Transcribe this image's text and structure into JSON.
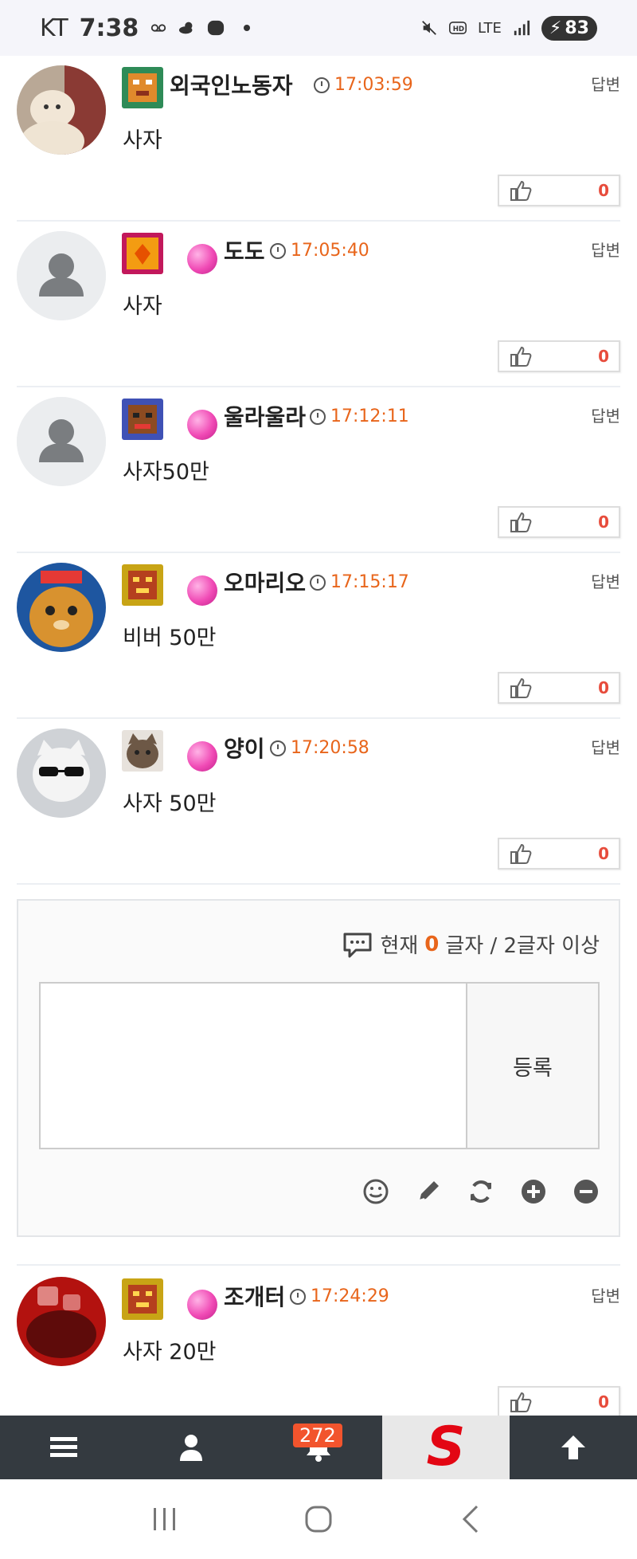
{
  "status_bar": {
    "carrier": "KT",
    "time": "7:38",
    "network": "LTE",
    "battery": "83"
  },
  "comments": [
    {
      "nick": "외국인노동자",
      "time": "17:03:59",
      "text": "사자",
      "reply": "답변",
      "likes": "0",
      "has_candy": false
    },
    {
      "nick": "도도",
      "time": "17:05:40",
      "text": "사자",
      "reply": "답변",
      "likes": "0",
      "has_candy": true
    },
    {
      "nick": "울라울라",
      "time": "17:12:11",
      "text": "사자50만",
      "reply": "답변",
      "likes": "0",
      "has_candy": true
    },
    {
      "nick": "오마리오",
      "time": "17:15:17",
      "text": "비버 50만",
      "reply": "답변",
      "likes": "0",
      "has_candy": true
    },
    {
      "nick": "양이",
      "time": "17:20:58",
      "text": "사자 50만",
      "reply": "답변",
      "likes": "0",
      "has_candy": true
    },
    {
      "nick": "조개터",
      "time": "17:24:29",
      "text": "사자 20만",
      "reply": "답변",
      "likes": "0",
      "has_candy": true
    }
  ],
  "write_form": {
    "count_prefix": "현재 ",
    "count_value": "0",
    "count_suffix": "글자 / 2글자 이상",
    "submit_label": "등록",
    "tools": [
      "smile-icon",
      "pencil-icon",
      "refresh-icon",
      "plus-circle-icon",
      "minus-circle-icon"
    ]
  },
  "bottom_nav": {
    "notification_count": "272",
    "logo_text": "S"
  },
  "colors": {
    "time_orange": "#e8651b",
    "like_red": "#e74c3c",
    "nav_dark": "#343a40",
    "badge_orange": "#f2542d",
    "logo_red": "#e30613"
  }
}
